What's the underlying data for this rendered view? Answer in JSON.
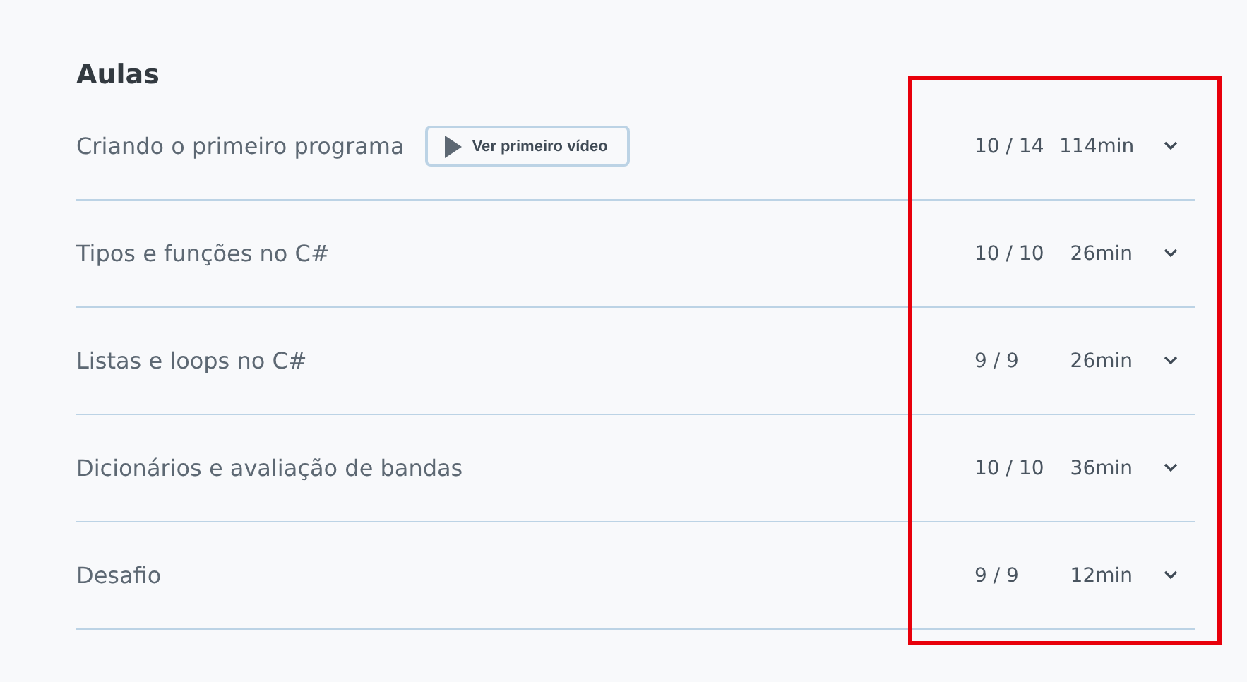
{
  "section": {
    "title": "Aulas",
    "lessons": [
      {
        "title": "Criando o primeiro programa",
        "button": "Ver primeiro vídeo",
        "progress": "10 / 14",
        "duration": "114min"
      },
      {
        "title": "Tipos e funções no C#",
        "progress": "10 / 10",
        "duration": "26min"
      },
      {
        "title": "Listas e loops no C#",
        "progress": "9 / 9",
        "duration": "26min"
      },
      {
        "title": "Dicionários e avaliação de bandas",
        "progress": "10 / 10",
        "duration": "36min"
      },
      {
        "title": "Desafio",
        "progress": "9 / 9",
        "duration": "12min"
      }
    ]
  },
  "annotation": {
    "kind": "rectangle"
  }
}
